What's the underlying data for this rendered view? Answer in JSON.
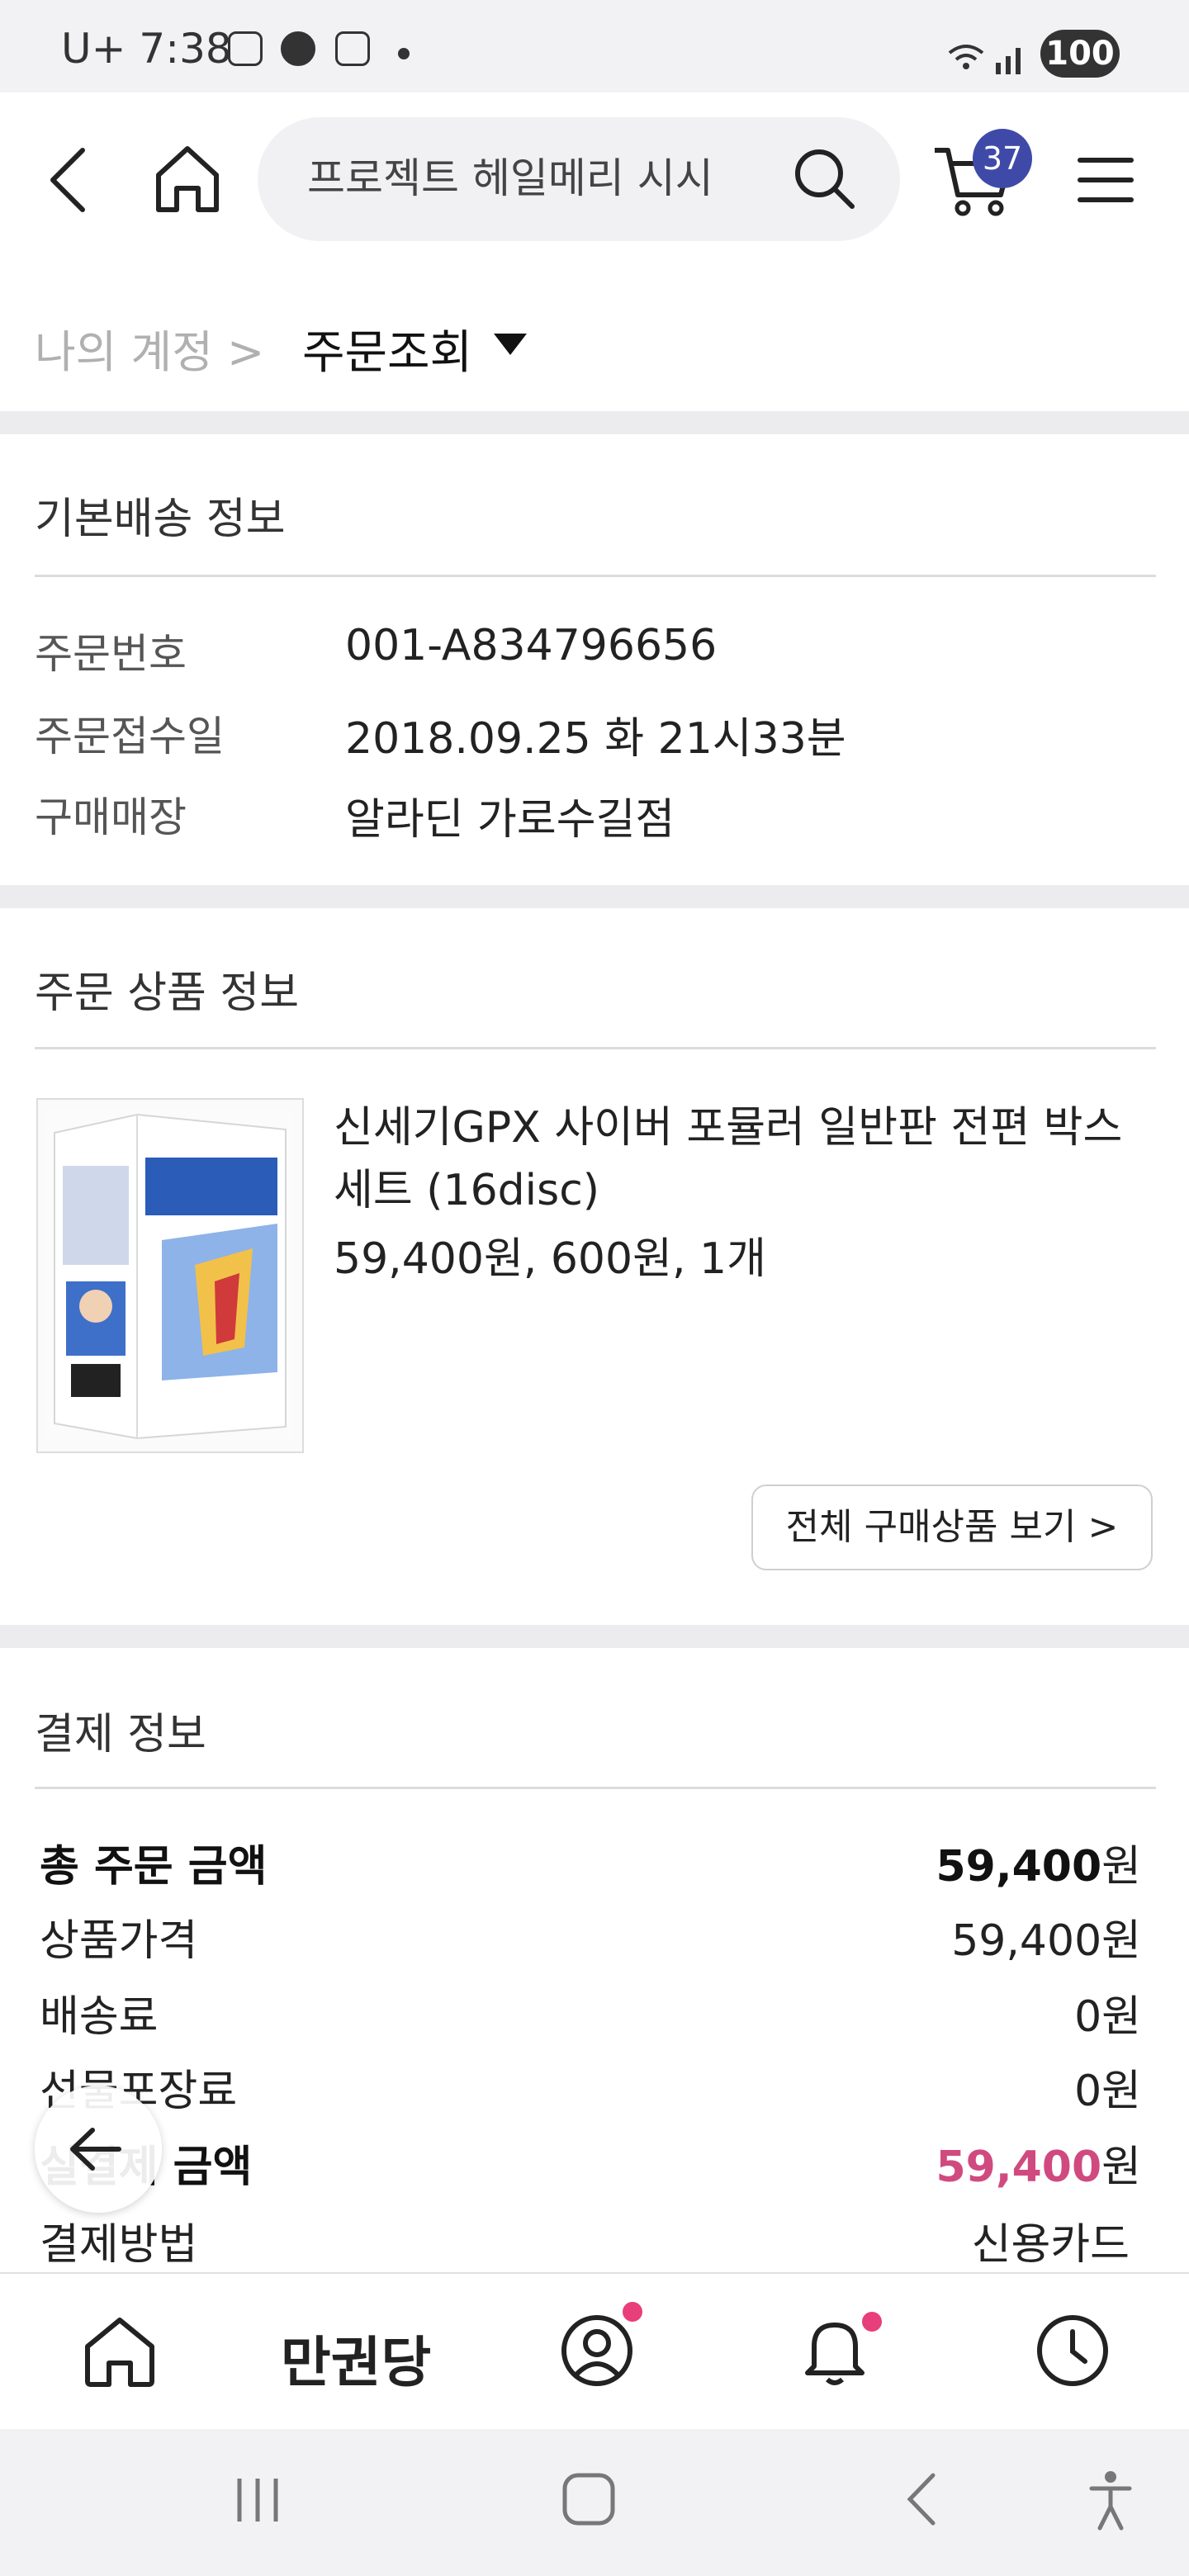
{
  "status_bar": {
    "time": "7:38",
    "carrier": "U+",
    "battery": "100",
    "icons": [
      "gallery-icon",
      "whatsapp-icon",
      "instagram-icon",
      "wifi-icon",
      "signal-icon"
    ]
  },
  "header": {
    "search_value": "프로젝트 헤일메리 시시",
    "cart_count": "37",
    "icons": [
      "back-icon",
      "home-icon",
      "search-icon",
      "cart-icon",
      "menu-icon"
    ]
  },
  "breadcrumb": {
    "parent": "나의 계정 >",
    "current": "주문조회"
  },
  "shipping": {
    "title": "기본배송 정보",
    "rows": [
      {
        "label": "주문번호",
        "value": "001-A834796656"
      },
      {
        "label": "주문접수일",
        "value": "2018.09.25 화 21시33분"
      },
      {
        "label": "구매매장",
        "value": "알라딘 가로수길점"
      }
    ]
  },
  "order_items": {
    "title": "주문 상품 정보",
    "product_title": "신세기GPX 사이버 포뮬러 일반판 전편 박스 세트 (16disc)",
    "product_price": "59,400원, 600원, 1개",
    "view_all": "전체 구매상품 보기 >"
  },
  "payment": {
    "title": "결제 정보",
    "total_label": "총 주문 금액",
    "total_value": "59,400",
    "price_label": "상품가격",
    "price_value": "59,400원",
    "shipping_label": "배송료",
    "shipping_value": "0원",
    "gift_label": "선물포장료",
    "gift_value": "0원",
    "paid_label": "실결제 금액",
    "paid_value": "59,400",
    "method_label": "결제방법",
    "method_value": "신용카드",
    "won": "원"
  },
  "bottom_nav": {
    "brand": "만권당"
  },
  "colors": {
    "accent_pink": "#d04a7f",
    "badge_blue": "#3f4aa8",
    "notif_dot": "#e83e7a"
  }
}
